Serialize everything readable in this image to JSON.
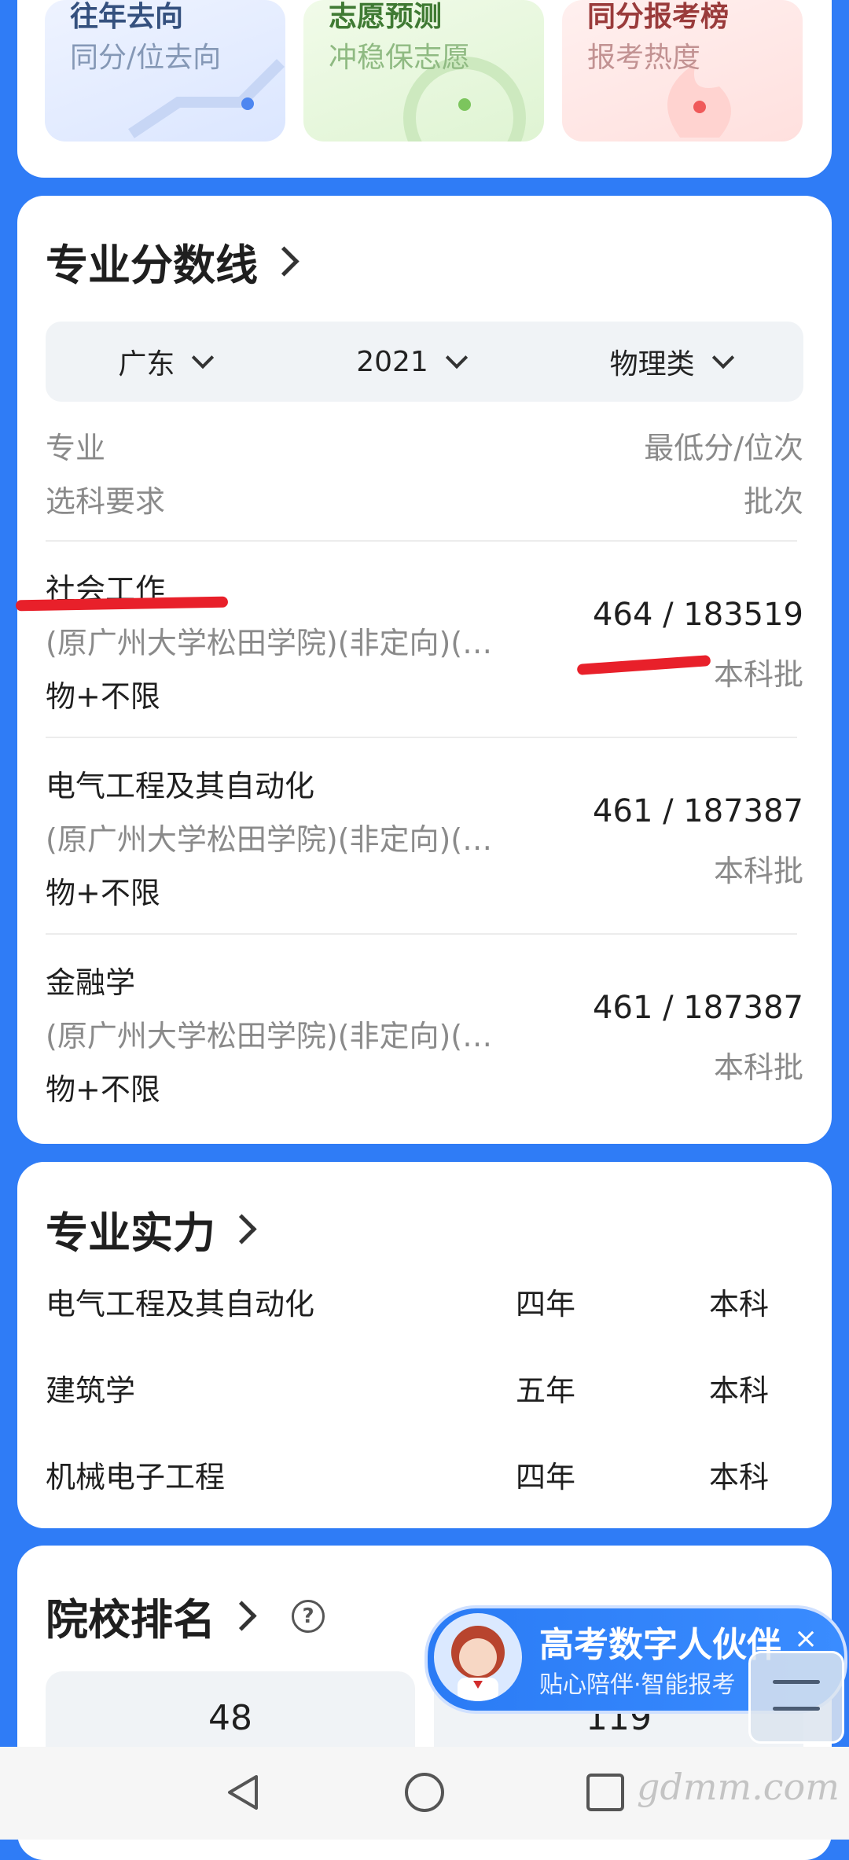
{
  "tiles": [
    {
      "title": "往年去向",
      "subtitle": "同分/位去向"
    },
    {
      "title": "志愿预测",
      "subtitle": "冲稳保志愿"
    },
    {
      "title": "同分报考榜",
      "subtitle": "报考热度"
    }
  ],
  "score_section": {
    "title": "专业分数线",
    "filters": {
      "province": "广东",
      "year": "2021",
      "category": "物理类"
    },
    "headers": {
      "major": "专业",
      "min_score_rank": "最低分/位次",
      "subject_req": "选科要求",
      "batch": "批次"
    },
    "rows": [
      {
        "name": "社会工作",
        "school": "(原广州大学松田学院)(非定向)(…",
        "subjects": "物+不限",
        "score": "464 / 183519",
        "batch": "本科批"
      },
      {
        "name": "电气工程及其自动化",
        "school": "(原广州大学松田学院)(非定向)(…",
        "subjects": "物+不限",
        "score": "461 / 187387",
        "batch": "本科批"
      },
      {
        "name": "金融学",
        "school": "(原广州大学松田学院)(非定向)(…",
        "subjects": "物+不限",
        "score": "461 / 187387",
        "batch": "本科批"
      }
    ]
  },
  "strength_section": {
    "title": "专业实力",
    "rows": [
      {
        "name": "电气工程及其自动化",
        "years": "四年",
        "level": "本科"
      },
      {
        "name": "建筑学",
        "years": "五年",
        "level": "本科"
      },
      {
        "name": "机械电子工程",
        "years": "四年",
        "level": "本科"
      }
    ]
  },
  "rank_section": {
    "title": "院校排名",
    "help_icon": "?",
    "values": [
      "48",
      "119"
    ]
  },
  "assistant": {
    "title": "高考数字人伙伴",
    "subtitle": "贴心陪伴·智能报考",
    "close_icon": "×"
  },
  "watermark": "gdmm.com",
  "colors": {
    "background": "#2f7cf6",
    "annotation_red": "#e8202a"
  }
}
